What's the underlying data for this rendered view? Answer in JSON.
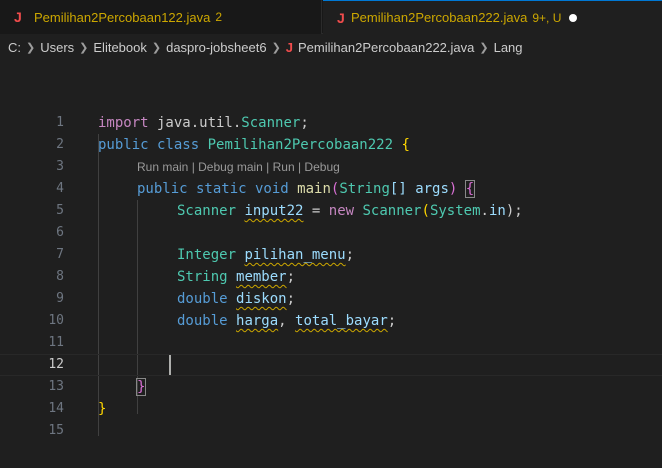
{
  "tabs": [
    {
      "label": "Pemilihan2Percobaan122.java",
      "badge": "2",
      "icon": "java-file-icon"
    },
    {
      "label": "Pemilihan2Percobaan222.java",
      "badge": "9+, U",
      "icon": "java-file-icon",
      "active": true
    }
  ],
  "breadcrumb": {
    "items": [
      "C:",
      "Users",
      "Elitebook",
      "daspro-jobsheet6",
      "Pemilihan2Percobaan222.java",
      "Lang"
    ]
  },
  "codelens": "Run main | Debug main | Run | Debug",
  "lines": {
    "n1": "1",
    "n2": "2",
    "n3": "3",
    "n4": "4",
    "n5": "5",
    "n6": "6",
    "n7": "7",
    "n8": "8",
    "n9": "9",
    "n10": "10",
    "n11": "11",
    "n12": "12",
    "n13": "13",
    "n14": "14",
    "n15": "15"
  },
  "code": {
    "import_kw": "import",
    "import_path": " java.util.",
    "import_cls": "Scanner",
    "import_end": ";",
    "pub": "public",
    "class_kw": " class ",
    "class_name": "Pemilihan2Percobaan222",
    "brace_open": " {",
    "main_mods": "public static void ",
    "main_name": "main",
    "main_paren": "(",
    "main_type": "String",
    "main_arr": "[] ",
    "main_arg": "args",
    "main_close": ") ",
    "main_brace": "{",
    "sc_type": "Scanner",
    "sc_var": "input22",
    "sc_eq": " = ",
    "sc_new": "new ",
    "sc_ctor": "Scanner",
    "sc_arg_cls": "System",
    "sc_dot": ".",
    "sc_arg_f": "in",
    "sc_end": ");",
    "int_type": "Integer",
    "int_var": "pilihan_menu",
    "semi": ";",
    "str_type": "String",
    "str_var": "member",
    "d1_type": "double",
    "d1_var": "diskon",
    "d2_type": "double",
    "d2_var1": "harga",
    "d2_comma": ", ",
    "d2_var2": "total_bayar",
    "close_inner": "}",
    "close_outer": "}"
  }
}
